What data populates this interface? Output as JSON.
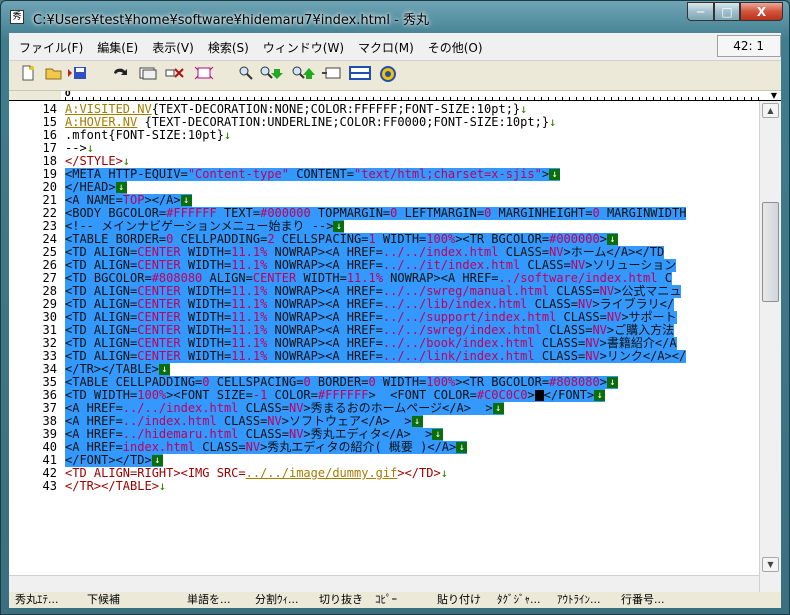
{
  "window": {
    "title": "C:¥Users¥test¥home¥software¥hidemaru7¥index.html  - 秀丸",
    "app_icon": "秀",
    "min_label": "─",
    "max_label": "□",
    "close_label": "X"
  },
  "menubar": {
    "items": [
      "ファイル(F)",
      "編集(E)",
      "表示(V)",
      "検索(S)",
      "ウィンドウ(W)",
      "マクロ(M)",
      "その他(O)"
    ],
    "cursor_position": "42: 1"
  },
  "toolbar": {
    "buttons": [
      "new-file",
      "open-file",
      "save-file",
      "undo",
      "copy",
      "cut",
      "paste",
      "search",
      "search-next",
      "search-prev",
      "replace",
      "split-window",
      "help"
    ]
  },
  "ruler": {
    "zero_label": "0",
    "arrow": "▼"
  },
  "editor": {
    "lines": [
      {
        "n": "14",
        "sel": false,
        "parts": [
          [
            "link",
            "A:VISITED.NV"
          ],
          [
            "plain",
            "{TEXT-DECORATION:NONE;COLOR:FFFFFF;FONT-SIZE:10pt;}"
          ],
          [
            "eol",
            "↓"
          ]
        ]
      },
      {
        "n": "15",
        "sel": false,
        "parts": [
          [
            "link",
            "A:HOVER.NV"
          ],
          [
            "plain",
            " {TEXT-DECORATION:UNDERLINE;COLOR:FF0000;FONT-SIZE:10pt;}"
          ],
          [
            "eol",
            "↓"
          ]
        ]
      },
      {
        "n": "16",
        "sel": false,
        "parts": [
          [
            "plain",
            ".mfont{FONT-SIZE:10pt}"
          ],
          [
            "eol",
            "↓"
          ]
        ]
      },
      {
        "n": "17",
        "sel": false,
        "parts": [
          [
            "plain",
            "-->"
          ],
          [
            "eol",
            "↓"
          ]
        ]
      },
      {
        "n": "18",
        "sel": false,
        "parts": [
          [
            "tag",
            "</STYLE>"
          ],
          [
            "eol",
            "↓"
          ]
        ]
      },
      {
        "n": "19",
        "sel": true,
        "parts": [
          [
            "sel",
            "<META HTTP-EQUIV="
          ],
          [
            "selval",
            "\"Content-type\""
          ],
          [
            "sel",
            " CONTENT="
          ],
          [
            "selval",
            "\"text/html;charset=x-sjis\""
          ],
          [
            "sel",
            ">"
          ],
          [
            "box",
            "↓"
          ]
        ]
      },
      {
        "n": "20",
        "sel": true,
        "parts": [
          [
            "sel",
            "</HEAD>"
          ],
          [
            "box",
            "↓"
          ]
        ]
      },
      {
        "n": "21",
        "sel": true,
        "parts": [
          [
            "sel",
            "<A NAME="
          ],
          [
            "selval",
            "TOP"
          ],
          [
            "sel",
            "></A>"
          ],
          [
            "box",
            "↓"
          ]
        ]
      },
      {
        "n": "22",
        "sel": true,
        "parts": [
          [
            "sel",
            "<BODY BGCOLOR="
          ],
          [
            "selval",
            "#FFFFFF"
          ],
          [
            "sel",
            " TEXT="
          ],
          [
            "selval",
            "#000000"
          ],
          [
            "sel",
            " TOPMARGIN="
          ],
          [
            "selval",
            "0"
          ],
          [
            "sel",
            " LEFTMARGIN="
          ],
          [
            "selval",
            "0"
          ],
          [
            "sel",
            " MARGINHEIGHT="
          ],
          [
            "selval",
            "0"
          ],
          [
            "sel",
            " MARGINWIDTH"
          ]
        ]
      },
      {
        "n": "23",
        "sel": true,
        "parts": [
          [
            "sel",
            "<!-- メインナビゲーションメニュー始まり -->"
          ],
          [
            "box",
            "↓"
          ]
        ]
      },
      {
        "n": "24",
        "sel": true,
        "parts": [
          [
            "sel",
            "<TABLE BORDER="
          ],
          [
            "selval",
            "0"
          ],
          [
            "sel",
            " CELLPADDING="
          ],
          [
            "selval",
            "2"
          ],
          [
            "sel",
            " CELLSPACING="
          ],
          [
            "selval",
            "1"
          ],
          [
            "sel",
            " WIDTH="
          ],
          [
            "selval",
            "100%"
          ],
          [
            "sel",
            "><TR BGCOLOR="
          ],
          [
            "selval",
            "#000000"
          ],
          [
            "sel",
            ">"
          ],
          [
            "box",
            "↓"
          ]
        ]
      },
      {
        "n": "25",
        "sel": true,
        "parts": [
          [
            "sel",
            "<TD ALIGN="
          ],
          [
            "selval",
            "CENTER"
          ],
          [
            "sel",
            " WIDTH="
          ],
          [
            "selval",
            "11.1%"
          ],
          [
            "sel",
            " NOWRAP><A HREF="
          ],
          [
            "selval",
            "../../index.html"
          ],
          [
            "sel",
            " CLASS="
          ],
          [
            "selval",
            "NV"
          ],
          [
            "sel",
            ">ホーム</A></TD"
          ]
        ]
      },
      {
        "n": "26",
        "sel": true,
        "parts": [
          [
            "sel",
            "<TD ALIGN="
          ],
          [
            "selval",
            "CENTER"
          ],
          [
            "sel",
            " WIDTH="
          ],
          [
            "selval",
            "11.1%"
          ],
          [
            "sel",
            " NOWRAP><A HREF="
          ],
          [
            "selval",
            "../../it/index.html"
          ],
          [
            "sel",
            " CLASS="
          ],
          [
            "selval",
            "NV"
          ],
          [
            "sel",
            ">ソリューション"
          ]
        ]
      },
      {
        "n": "27",
        "sel": true,
        "parts": [
          [
            "sel",
            "<TD BGCOLOR="
          ],
          [
            "selval",
            "#808080"
          ],
          [
            "sel",
            " ALIGN="
          ],
          [
            "selval",
            "CENTER"
          ],
          [
            "sel",
            " WIDTH="
          ],
          [
            "selval",
            "11.1%"
          ],
          [
            "sel",
            " NOWRAP><A HREF="
          ],
          [
            "selval",
            "../software/index.html"
          ],
          [
            "sel",
            " C"
          ]
        ]
      },
      {
        "n": "28",
        "sel": true,
        "parts": [
          [
            "sel",
            "<TD ALIGN="
          ],
          [
            "selval",
            "CENTER"
          ],
          [
            "sel",
            " WIDTH="
          ],
          [
            "selval",
            "11.1%"
          ],
          [
            "sel",
            " NOWRAP><A HREF="
          ],
          [
            "selval",
            "../../swreg/manual.html"
          ],
          [
            "sel",
            " CLASS="
          ],
          [
            "selval",
            "NV"
          ],
          [
            "sel",
            ">公式マニュ"
          ]
        ]
      },
      {
        "n": "29",
        "sel": true,
        "parts": [
          [
            "sel",
            "<TD ALIGN="
          ],
          [
            "selval",
            "CENTER"
          ],
          [
            "sel",
            " WIDTH="
          ],
          [
            "selval",
            "11.1%"
          ],
          [
            "sel",
            " NOWRAP><A HREF="
          ],
          [
            "selval",
            "../../lib/index.html"
          ],
          [
            "sel",
            " CLASS="
          ],
          [
            "selval",
            "NV"
          ],
          [
            "sel",
            ">ライブラリ</"
          ]
        ]
      },
      {
        "n": "30",
        "sel": true,
        "parts": [
          [
            "sel",
            "<TD ALIGN="
          ],
          [
            "selval",
            "CENTER"
          ],
          [
            "sel",
            " WIDTH="
          ],
          [
            "selval",
            "11.1%"
          ],
          [
            "sel",
            " NOWRAP><A HREF="
          ],
          [
            "selval",
            "../../support/index.html"
          ],
          [
            "sel",
            " CLASS="
          ],
          [
            "selval",
            "NV"
          ],
          [
            "sel",
            ">サポート"
          ]
        ]
      },
      {
        "n": "31",
        "sel": true,
        "parts": [
          [
            "sel",
            "<TD ALIGN="
          ],
          [
            "selval",
            "CENTER"
          ],
          [
            "sel",
            " WIDTH="
          ],
          [
            "selval",
            "11.1%"
          ],
          [
            "sel",
            " NOWRAP><A HREF="
          ],
          [
            "selval",
            "../../swreg/index.html"
          ],
          [
            "sel",
            " CLASS="
          ],
          [
            "selval",
            "NV"
          ],
          [
            "sel",
            ">ご購入方法"
          ]
        ]
      },
      {
        "n": "32",
        "sel": true,
        "parts": [
          [
            "sel",
            "<TD ALIGN="
          ],
          [
            "selval",
            "CENTER"
          ],
          [
            "sel",
            " WIDTH="
          ],
          [
            "selval",
            "11.1%"
          ],
          [
            "sel",
            " NOWRAP><A HREF="
          ],
          [
            "selval",
            "../../book/index.html"
          ],
          [
            "sel",
            " CLASS="
          ],
          [
            "selval",
            "NV"
          ],
          [
            "sel",
            ">書籍紹介</A"
          ]
        ]
      },
      {
        "n": "33",
        "sel": true,
        "parts": [
          [
            "sel",
            "<TD ALIGN="
          ],
          [
            "selval",
            "CENTER"
          ],
          [
            "sel",
            " WIDTH="
          ],
          [
            "selval",
            "11.1%"
          ],
          [
            "sel",
            " NOWRAP><A HREF="
          ],
          [
            "selval",
            "../../link/index.html"
          ],
          [
            "sel",
            " CLASS="
          ],
          [
            "selval",
            "NV"
          ],
          [
            "sel",
            ">リンク</A></"
          ]
        ]
      },
      {
        "n": "34",
        "sel": true,
        "parts": [
          [
            "sel",
            "</TR></TABLE>"
          ],
          [
            "box",
            "↓"
          ]
        ]
      },
      {
        "n": "35",
        "sel": true,
        "parts": [
          [
            "sel",
            "<TABLE CELLPADDING="
          ],
          [
            "selval",
            "0"
          ],
          [
            "sel",
            " CELLSPACING="
          ],
          [
            "selval",
            "0"
          ],
          [
            "sel",
            " BORDER="
          ],
          [
            "selval",
            "0"
          ],
          [
            "sel",
            " WIDTH="
          ],
          [
            "selval",
            "100%"
          ],
          [
            "sel",
            "><TR BGCOLOR="
          ],
          [
            "selval",
            "#808080"
          ],
          [
            "sel",
            ">"
          ],
          [
            "box",
            "↓"
          ]
        ]
      },
      {
        "n": "36",
        "sel": true,
        "parts": [
          [
            "sel",
            "<TD WIDTH="
          ],
          [
            "selval",
            "100%"
          ],
          [
            "sel",
            "><FONT SIZE="
          ],
          [
            "selval",
            "-1"
          ],
          [
            "sel",
            " COLOR="
          ],
          [
            "selval",
            "#FFFFFF"
          ],
          [
            "sel",
            ">  <FONT COLOR="
          ],
          [
            "selval",
            "#C0C0C0"
          ],
          [
            "sel",
            ">"
          ],
          [
            "cursor",
            ""
          ],
          [
            "sel",
            "</FONT>"
          ],
          [
            "box",
            "↓"
          ]
        ]
      },
      {
        "n": "37",
        "sel": true,
        "parts": [
          [
            "sel",
            "<A HREF="
          ],
          [
            "selval",
            "../../index.html"
          ],
          [
            "sel",
            " CLASS="
          ],
          [
            "selval",
            "NV"
          ],
          [
            "sel",
            ">秀まるおのホームページ</A>  >"
          ],
          [
            "box",
            "↓"
          ]
        ]
      },
      {
        "n": "38",
        "sel": true,
        "parts": [
          [
            "sel",
            "<A HREF="
          ],
          [
            "selval",
            "../index.html"
          ],
          [
            "sel",
            " CLASS="
          ],
          [
            "selval",
            "NV"
          ],
          [
            "sel",
            ">ソフトウェア</A>  >"
          ],
          [
            "box",
            "↓"
          ]
        ]
      },
      {
        "n": "39",
        "sel": true,
        "parts": [
          [
            "sel",
            "<A HREF="
          ],
          [
            "selval",
            "../hidemaru.html"
          ],
          [
            "sel",
            " CLASS="
          ],
          [
            "selval",
            "NV"
          ],
          [
            "sel",
            ">秀丸エディタ</A>  >"
          ],
          [
            "box",
            "↓"
          ]
        ]
      },
      {
        "n": "40",
        "sel": true,
        "parts": [
          [
            "sel",
            "<A HREF="
          ],
          [
            "selval",
            "index.html"
          ],
          [
            "sel",
            " CLASS="
          ],
          [
            "selval",
            "NV"
          ],
          [
            "sel",
            ">秀丸エディタの紹介( 概要 )</A>"
          ],
          [
            "box",
            "↓"
          ]
        ]
      },
      {
        "n": "41",
        "sel": true,
        "parts": [
          [
            "sel",
            "</FONT></TD>"
          ],
          [
            "box",
            "↓"
          ]
        ]
      },
      {
        "n": "42",
        "sel": false,
        "parts": [
          [
            "tag",
            "<TD ALIGN=RIGHT><IMG SRC="
          ],
          [
            "link",
            "../../image/dummy.gif"
          ],
          [
            "tag",
            "></TD>"
          ],
          [
            "eol",
            "↓"
          ]
        ]
      },
      {
        "n": "43",
        "sel": false,
        "parts": [
          [
            "tag",
            "</TR></TABLE>"
          ],
          [
            "eol",
            "↓"
          ]
        ]
      }
    ]
  },
  "scrollbar": {
    "up": "▲",
    "down": "▼",
    "left": "◀",
    "right": "▶"
  },
  "statusbar": {
    "fkeys": [
      "秀丸ｴﾃ...",
      "",
      "下候補",
      "",
      "単語を...",
      "分割ｳｨ...",
      "切り抜き",
      "ｺﾋﾟｰ",
      "",
      "貼り付け",
      "ﾀｸﾞｼﾞｬ...",
      "ｱｳﾄﾗｲﾝ...",
      "行番号..."
    ]
  }
}
